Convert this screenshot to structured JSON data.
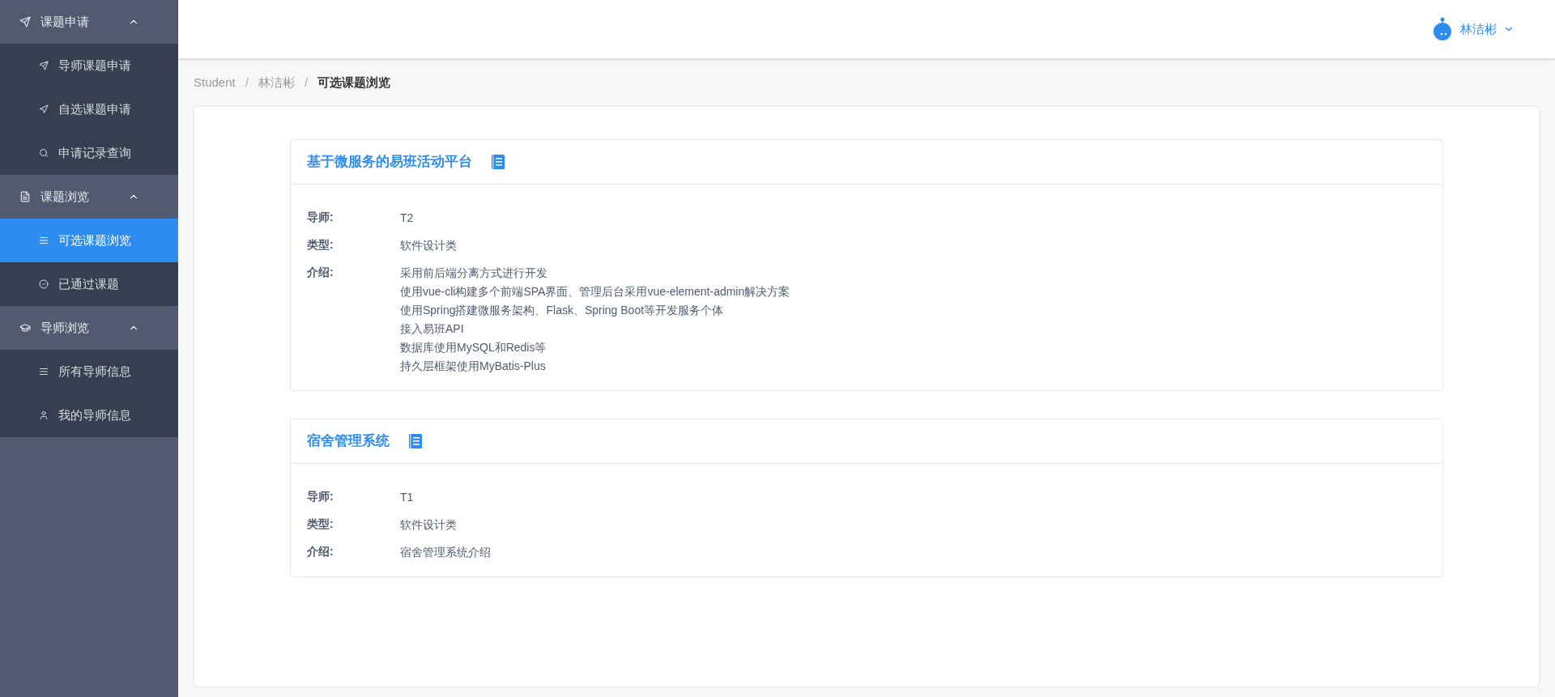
{
  "sidebar": {
    "groups": [
      {
        "label": "课题申请",
        "expanded": true,
        "items": [
          {
            "label": "导师课题申请",
            "selected": false
          },
          {
            "label": "自选课题申请",
            "selected": false
          },
          {
            "label": "申请记录查询",
            "selected": false
          }
        ]
      },
      {
        "label": "课题浏览",
        "expanded": true,
        "items": [
          {
            "label": "可选课题浏览",
            "selected": true
          },
          {
            "label": "已通过课题",
            "selected": false
          }
        ]
      },
      {
        "label": "导师浏览",
        "expanded": true,
        "items": [
          {
            "label": "所有导师信息",
            "selected": false
          },
          {
            "label": "我的导师信息",
            "selected": false
          }
        ]
      }
    ]
  },
  "header": {
    "user": "林洁彬"
  },
  "breadcrumb": [
    {
      "kind": "link",
      "text": "Student"
    },
    {
      "kind": "separator",
      "text": "/"
    },
    {
      "kind": "link",
      "text": "林洁彬"
    },
    {
      "kind": "separator",
      "text": "/"
    },
    {
      "kind": "current",
      "text": "可选课题浏览"
    }
  ],
  "topics": [
    {
      "title": "基于微服务的易班活动平台",
      "fields": [
        {
          "label": "导师:",
          "lines": [
            "T2"
          ]
        },
        {
          "label": "类型:",
          "lines": [
            "软件设计类"
          ]
        },
        {
          "label": "介绍:",
          "lines": [
            "采用前后端分离方式进行开发",
            "使用vue-cli构建多个前端SPA界面、管理后台采用vue-element-admin解决方案",
            "使用Spring搭建微服务架构、Flask、Spring Boot等开发服务个体",
            "接入易班API",
            "数据库使用MySQL和Redis等",
            "持久层框架使用MyBatis-Plus"
          ]
        }
      ]
    },
    {
      "title": "宿舍管理系统",
      "fields": [
        {
          "label": "导师:",
          "lines": [
            "T1"
          ]
        },
        {
          "label": "类型:",
          "lines": [
            "软件设计类"
          ]
        },
        {
          "label": "介绍:",
          "lines": [
            "宿舍管理系统介绍"
          ]
        }
      ]
    }
  ]
}
